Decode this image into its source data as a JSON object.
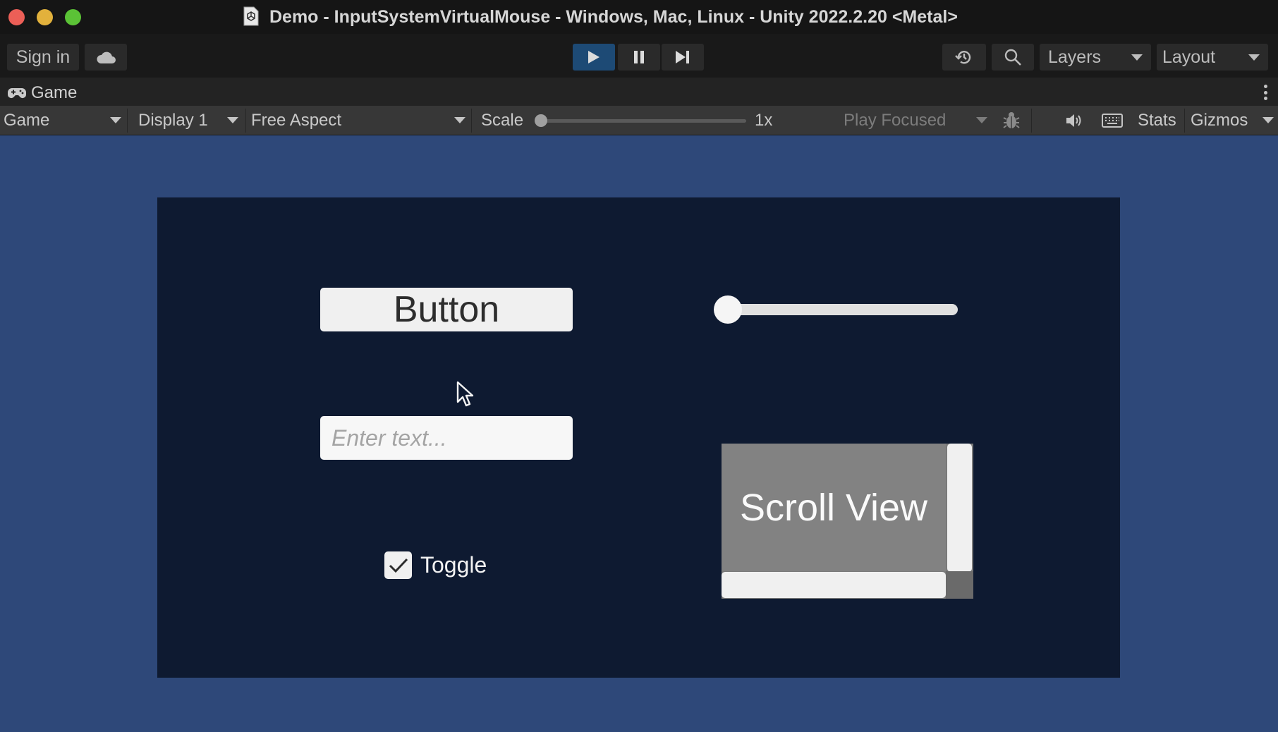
{
  "window": {
    "title": "Demo - InputSystemVirtualMouse - Windows, Mac, Linux - Unity 2022.2.20 <Metal>",
    "traffic_lights": {
      "close": "#ec5f57",
      "minimize": "#e2b13c",
      "zoom": "#5bc236"
    }
  },
  "toolbar": {
    "sign_in_label": "Sign in",
    "cloud_icon": "cloud-icon",
    "play_icon": "play-icon",
    "pause_icon": "pause-icon",
    "step_icon": "step-icon",
    "history_icon": "history-icon",
    "search_icon": "search-icon",
    "layers_label": "Layers",
    "layout_label": "Layout",
    "play_active_color": "#1d4a75"
  },
  "tab": {
    "label": "Game",
    "icon": "gamepad-icon"
  },
  "game_toolbar": {
    "view_dropdown": "Game",
    "display_dropdown": "Display 1",
    "aspect_dropdown": "Free Aspect",
    "scale_label": "Scale",
    "scale_value": "1x",
    "play_mode_dropdown": "Play Focused",
    "bug_icon": "bug-icon",
    "audio_icon": "speaker-icon",
    "keyboard_icon": "keyboard-icon",
    "stats_label": "Stats",
    "gizmos_label": "Gizmos"
  },
  "game": {
    "background_color": "#2e4879",
    "canvas_color": "#0e1a31",
    "button_label": "Button",
    "input": {
      "value": "",
      "placeholder": "Enter text..."
    },
    "toggle": {
      "label": "Toggle",
      "checked": true
    },
    "slider": {
      "value": 0.0,
      "min": 0,
      "max": 1
    },
    "scroll_view": {
      "content_text": "Scroll View"
    }
  }
}
